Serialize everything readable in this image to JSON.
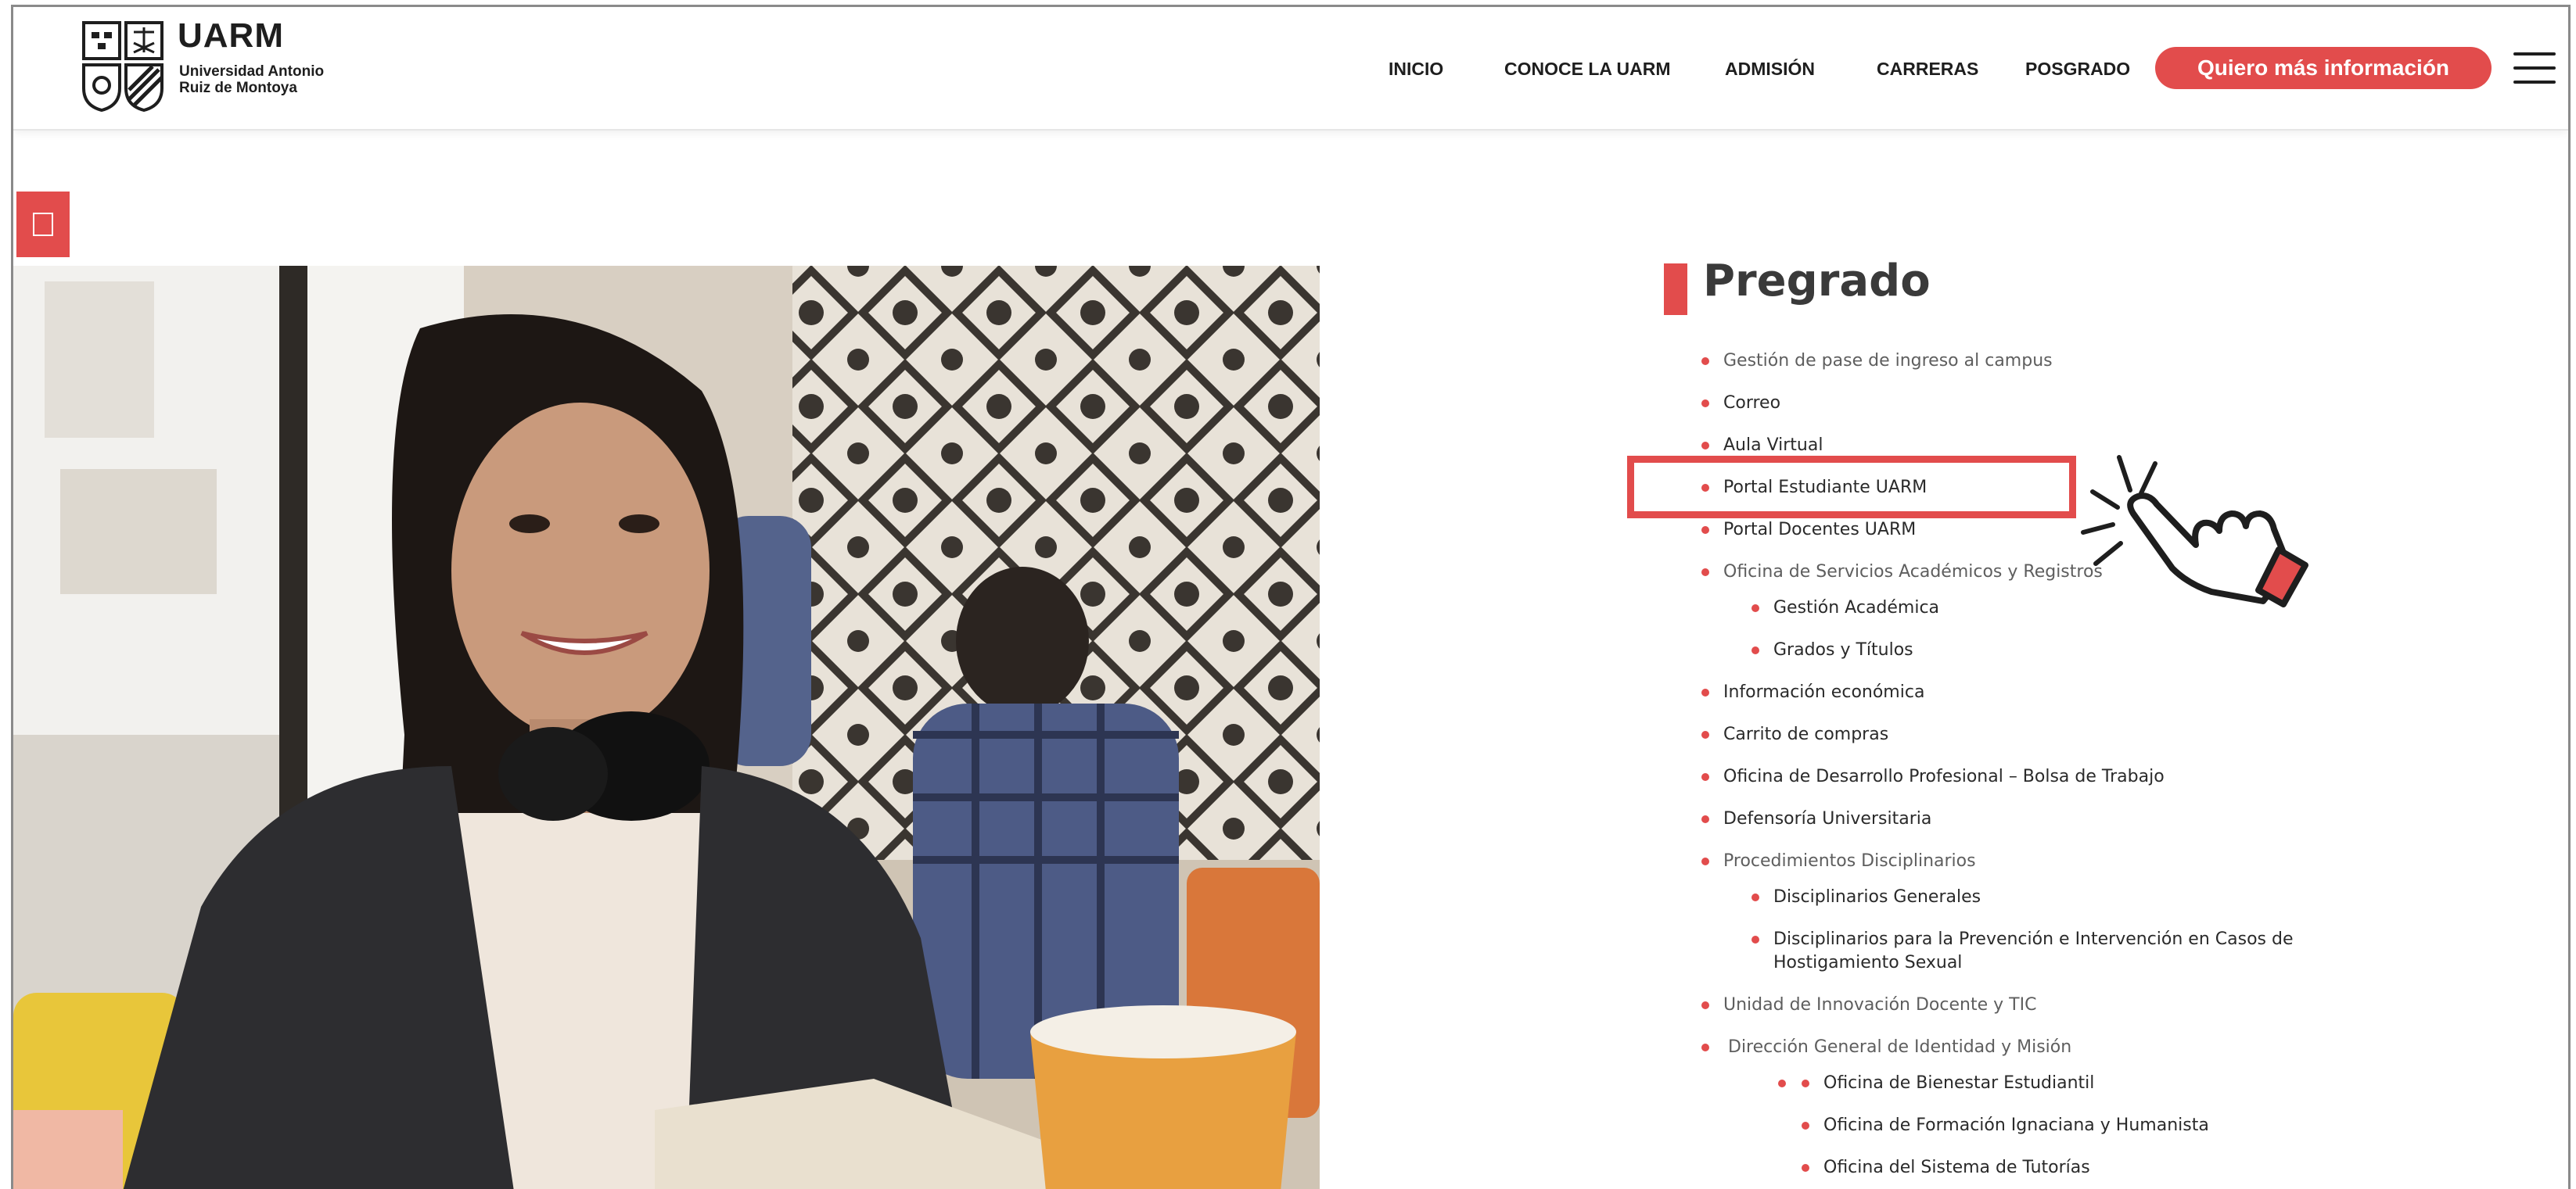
{
  "header": {
    "logo_title": "UARM",
    "logo_subtitle": "Universidad Antonio Ruiz de Montoya",
    "nav": [
      "INICIO",
      "CONOCE LA UARM",
      "ADMISIÓN",
      "CARRERAS",
      "POSGRADO"
    ],
    "cta_label": "Quiero más información"
  },
  "content": {
    "section_title": "Pregrado",
    "items": [
      {
        "label": "Gestión de pase de ingreso al campus",
        "muted": true
      },
      {
        "label": "Correo"
      },
      {
        "label": "Aula Virtual"
      },
      {
        "label": "Portal Estudiante UARM",
        "highlighted": true
      },
      {
        "label": "Portal Docentes UARM"
      },
      {
        "label": "Oficina de Servicios Académicos y Registros",
        "muted": true
      },
      {
        "label": "Gestión Académica",
        "level": 2
      },
      {
        "label": "Grados y Títulos",
        "level": 2
      },
      {
        "label": "Información económica"
      },
      {
        "label": "Carrito de compras"
      },
      {
        "label": "Oficina de Desarrollo Profesional – Bolsa de Trabajo"
      },
      {
        "label": "Defensoría Universitaria"
      },
      {
        "label": "Procedimientos Disciplinarios",
        "muted": true
      },
      {
        "label": "Disciplinarios Generales",
        "level": 2
      },
      {
        "label": "Disciplinarios para la Prevención e Intervención en Casos de",
        "level": 2
      },
      {
        "label": "Hostigamiento Sexual",
        "level": 2,
        "continuation": true
      },
      {
        "label": "Unidad de Innovación Docente y TIC",
        "muted": true
      },
      {
        "label": "Dirección General de Identidad y Misión",
        "muted": true
      },
      {
        "label": "Oficina de Bienestar Estudiantil",
        "level": 3
      },
      {
        "label": "Oficina de Formación Ignaciana y Humanista",
        "level": 3
      },
      {
        "label": "Oficina del Sistema de Tutorías",
        "level": 3
      }
    ]
  },
  "colors": {
    "accent": "#e24c4c",
    "text": "#2a2a2a"
  },
  "icons": {
    "menu": "hamburger-menu-icon",
    "pointer": "pointing-hand-icon"
  }
}
